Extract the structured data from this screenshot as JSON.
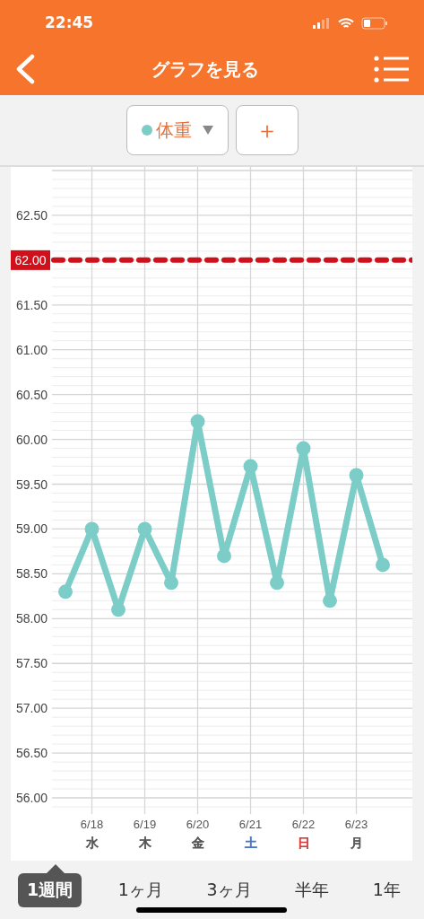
{
  "status_bar": {
    "time": "22:45"
  },
  "header": {
    "title": "グラフを見る"
  },
  "toolbar": {
    "add_button": "＋"
  },
  "chart_data": {
    "type": "line",
    "grid": true,
    "ylim": [
      55.9,
      63.0
    ],
    "categories": [
      null,
      "6/18",
      null,
      "6/19",
      null,
      "6/20",
      null,
      "6/21",
      null,
      "6/22",
      null,
      "6/23",
      null
    ],
    "yticks": [
      {
        "value": 56,
        "label": "56.00"
      },
      {
        "value": 56.5,
        "label": "56.50"
      },
      {
        "value": 57,
        "label": "57.00"
      },
      {
        "value": 57.5,
        "label": "57.50"
      },
      {
        "value": 58,
        "label": "58.00"
      },
      {
        "value": 58.5,
        "label": "58.50"
      },
      {
        "value": 59,
        "label": "59.00"
      },
      {
        "value": 59.5,
        "label": "59.50"
      },
      {
        "value": 60,
        "label": "60.00"
      },
      {
        "value": 60.5,
        "label": "60.50"
      },
      {
        "value": 61,
        "label": "61.00"
      },
      {
        "value": 61.5,
        "label": "61.50"
      },
      {
        "value": 62.5,
        "label": "62.50"
      }
    ],
    "series": [
      {
        "name": "体重",
        "color": "#7ccdc8",
        "marker": "circle",
        "values": [
          58.3,
          59.0,
          58.1,
          59.0,
          58.4,
          60.2,
          58.7,
          59.7,
          58.4,
          59.9,
          58.2,
          59.6,
          58.6
        ]
      }
    ],
    "ref_lines": [
      {
        "axis": "y",
        "value": 62,
        "label": "62.00",
        "color": "#d0101a"
      }
    ]
  },
  "day_labels": [
    {
      "weekday": "水",
      "color": "#555555"
    },
    {
      "weekday": "木",
      "color": "#555555"
    },
    {
      "weekday": "金",
      "color": "#555555"
    },
    {
      "weekday": "土",
      "color": "#4a74c9"
    },
    {
      "weekday": "日",
      "color": "#d63a3a"
    },
    {
      "weekday": "月",
      "color": "#555555"
    }
  ],
  "periods": [
    {
      "label": "1週間",
      "selected": true
    },
    {
      "label": "1ヶ月",
      "selected": false
    },
    {
      "label": "3ヶ月",
      "selected": false
    },
    {
      "label": "半年",
      "selected": false
    },
    {
      "label": "1年",
      "selected": false
    }
  ]
}
